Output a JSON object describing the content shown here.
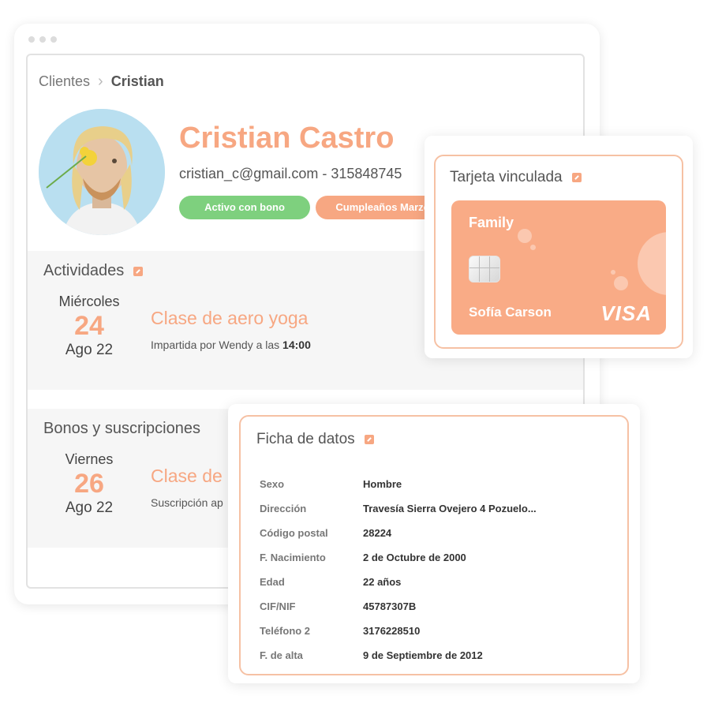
{
  "breadcrumb": {
    "root": "Clientes",
    "current": "Cristian"
  },
  "client": {
    "name": "Cristian Castro",
    "contact": "cristian_c@gmail.com - 315848745",
    "badges": {
      "active": "Activo con bono",
      "birthday": "Cumpleaños Marzo"
    }
  },
  "activities": {
    "title": "Actividades",
    "date": {
      "dow": "Miércoles",
      "day": "24",
      "month": "Ago 22"
    },
    "event": {
      "title": "Clase de aero yoga",
      "sub_prefix": "Impartida por Wendy  a las ",
      "time": "14:00"
    }
  },
  "subscriptions": {
    "title": "Bonos y suscripciones",
    "date": {
      "dow": "Viernes",
      "day": "26",
      "month": "Ago 22"
    },
    "event": {
      "title": "Clase de",
      "sub": "Suscripción ap"
    }
  },
  "card": {
    "title": "Tarjeta vinculada",
    "type": "Family",
    "holder": "Sofía Carson",
    "brand": "VISA",
    "color": "#f9ab86"
  },
  "datasheet": {
    "title": "Ficha de datos",
    "rows": [
      {
        "label": "Sexo",
        "value": "Hombre"
      },
      {
        "label": "Dirección",
        "value": "Travesía Sierra Ovejero 4 Pozuelo..."
      },
      {
        "label": "Código postal",
        "value": "28224"
      },
      {
        "label": "F. Nacimiento",
        "value": "2 de Octubre de 2000"
      },
      {
        "label": "Edad",
        "value": "22 años"
      },
      {
        "label": "CIF/NIF",
        "value": "45787307B"
      },
      {
        "label": "Teléfono 2",
        "value": "3176228510"
      },
      {
        "label": "F. de alta",
        "value": "9 de Septiembre de 2012"
      }
    ]
  },
  "colors": {
    "accent": "#f7a782",
    "success": "#7ed07e",
    "border": "#f6c1a4"
  },
  "icons": {
    "external": "external-link-icon",
    "chevron": "chevron-right-icon"
  }
}
